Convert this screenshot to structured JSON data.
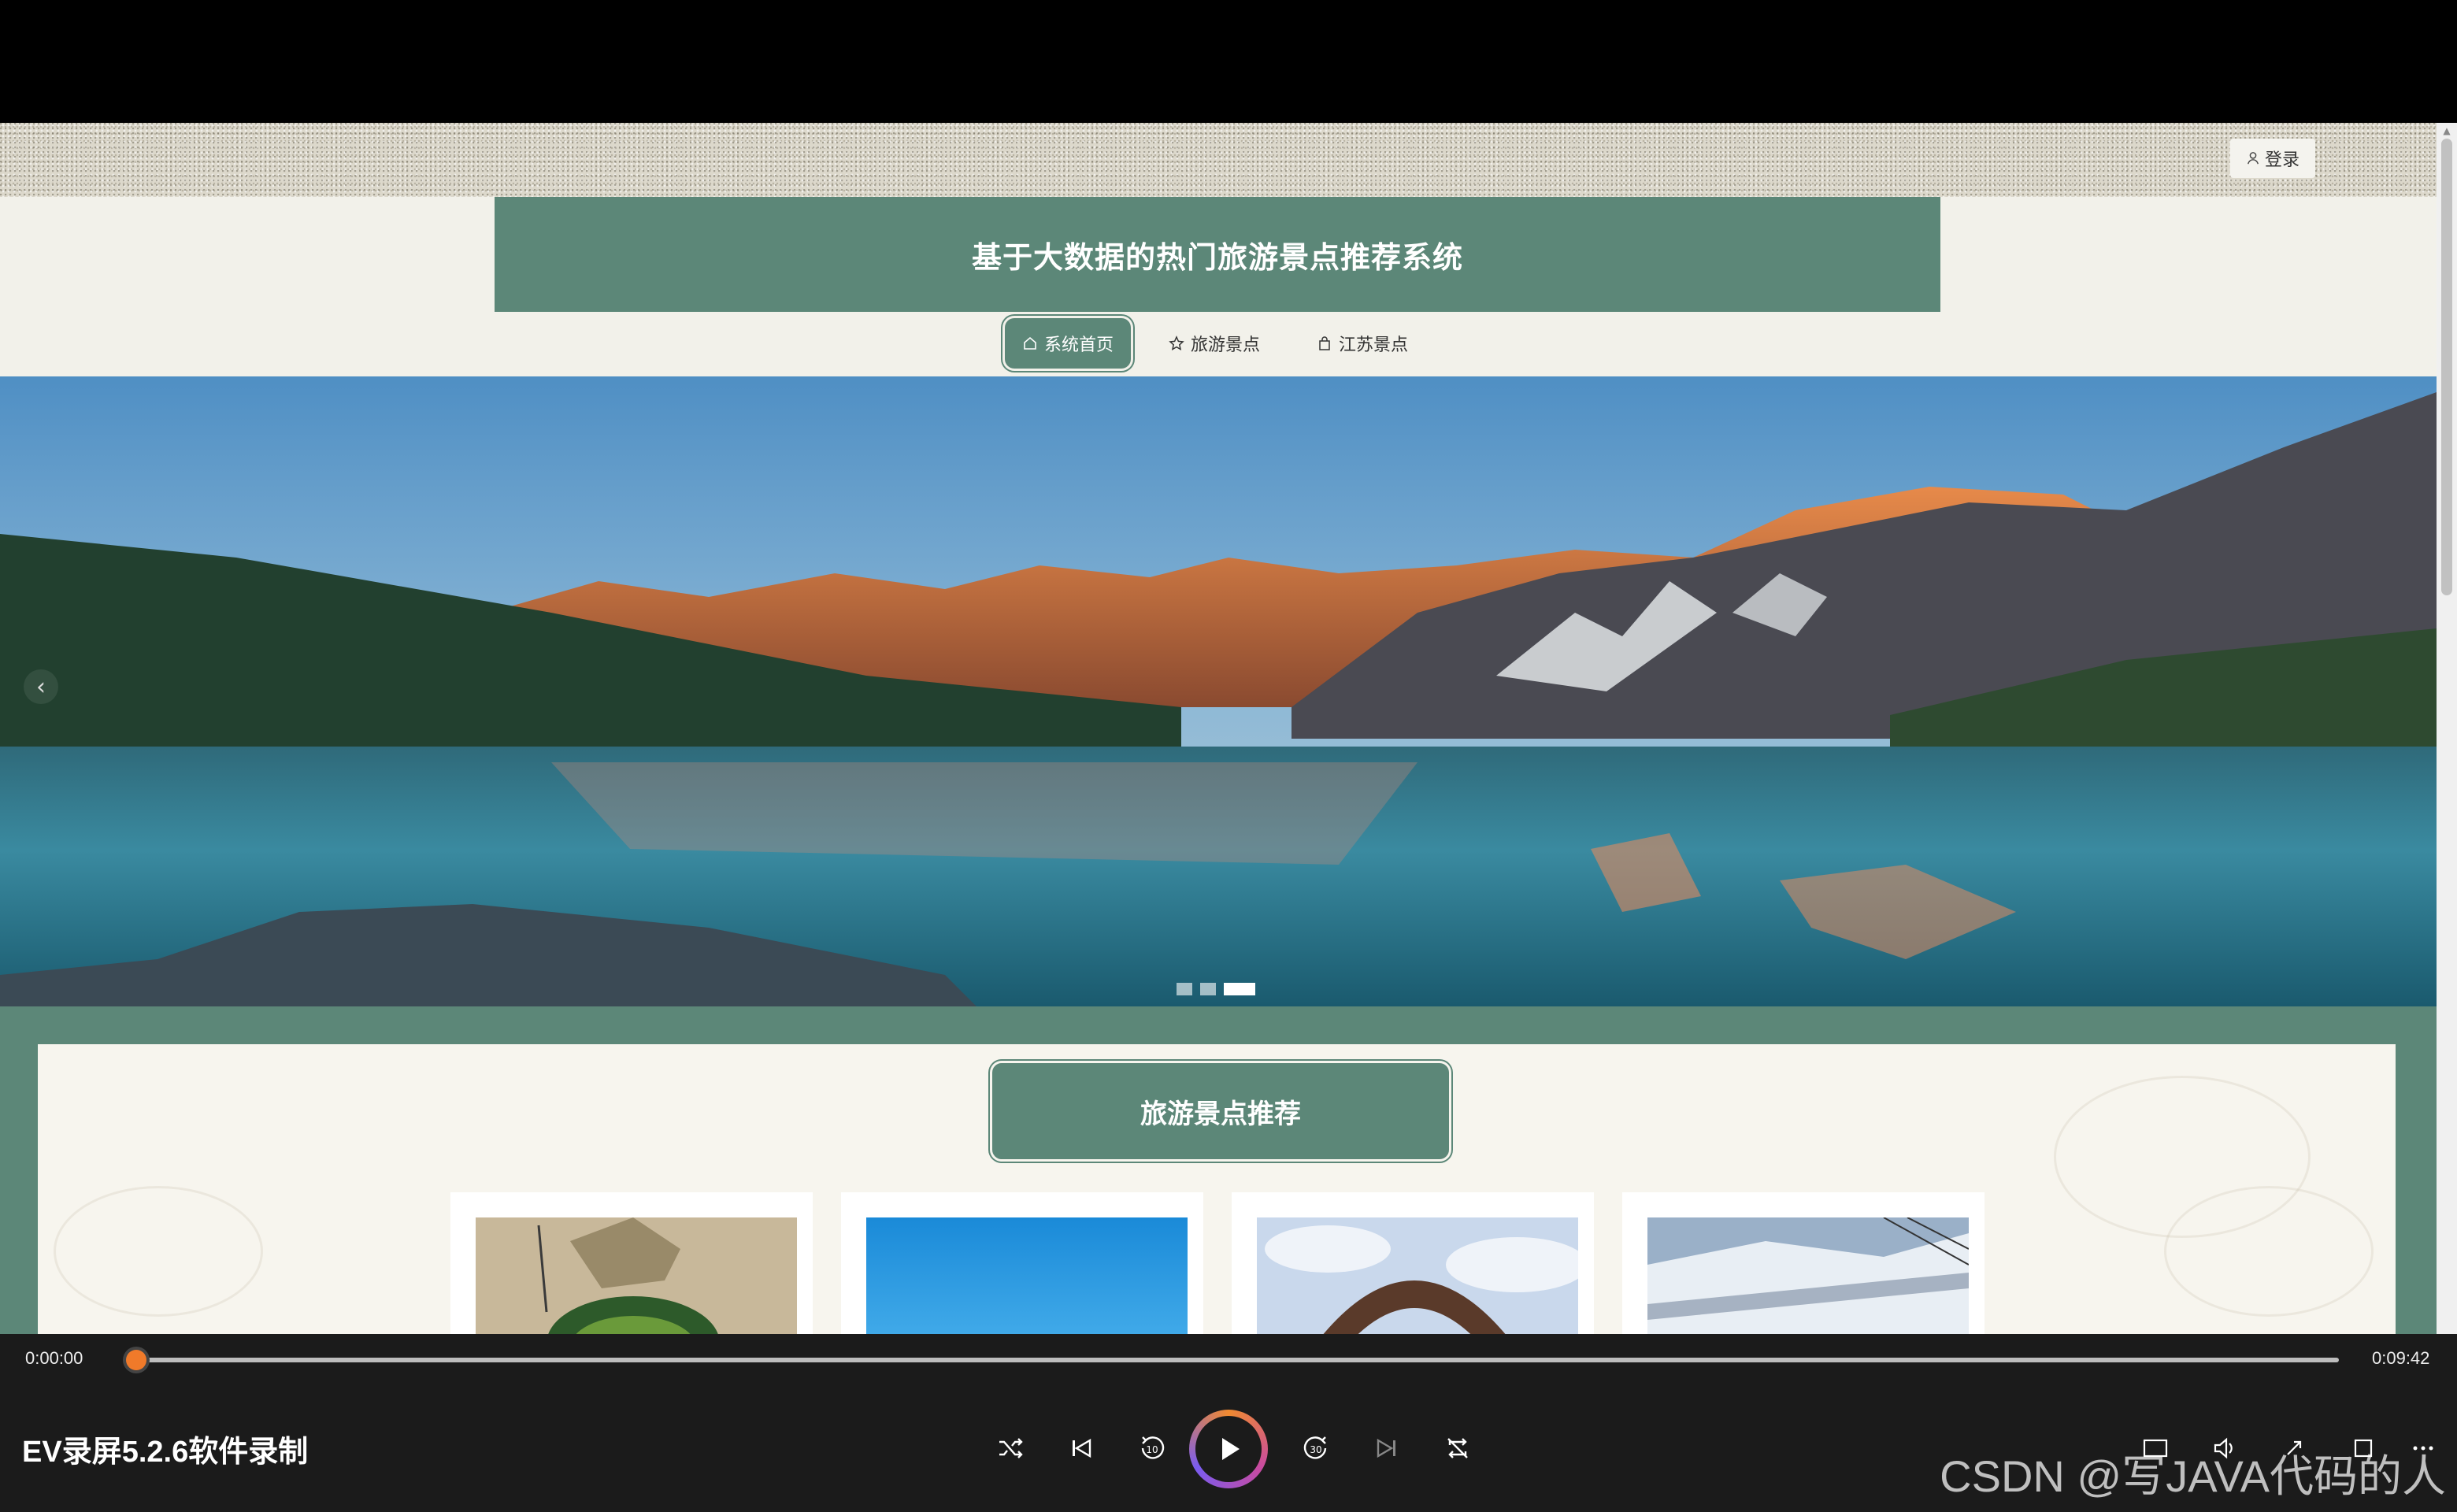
{
  "site": {
    "login_label": "登录",
    "title": "基于大数据的热门旅游景点推荐系统",
    "nav": [
      {
        "label": "系统首页",
        "icon": "home-icon",
        "active": true
      },
      {
        "label": "旅游景点",
        "icon": "star-icon",
        "active": false
      },
      {
        "label": "江苏景点",
        "icon": "bag-icon",
        "active": false
      }
    ],
    "carousel": {
      "prev_symbol": "‹",
      "slide_count": 3,
      "active_index": 2
    },
    "recommend": {
      "title": "旅游景点推荐"
    }
  },
  "player": {
    "current_time": "0:00:00",
    "duration": "0:09:42",
    "progress": 0.0,
    "app_label": "EV录屏5.2.6软件录制",
    "accent": "#f07a2a"
  },
  "watermark": "CSDN @写JAVA代码的人",
  "colors": {
    "brand": "#5c8778",
    "background": "#f2f1ea"
  }
}
